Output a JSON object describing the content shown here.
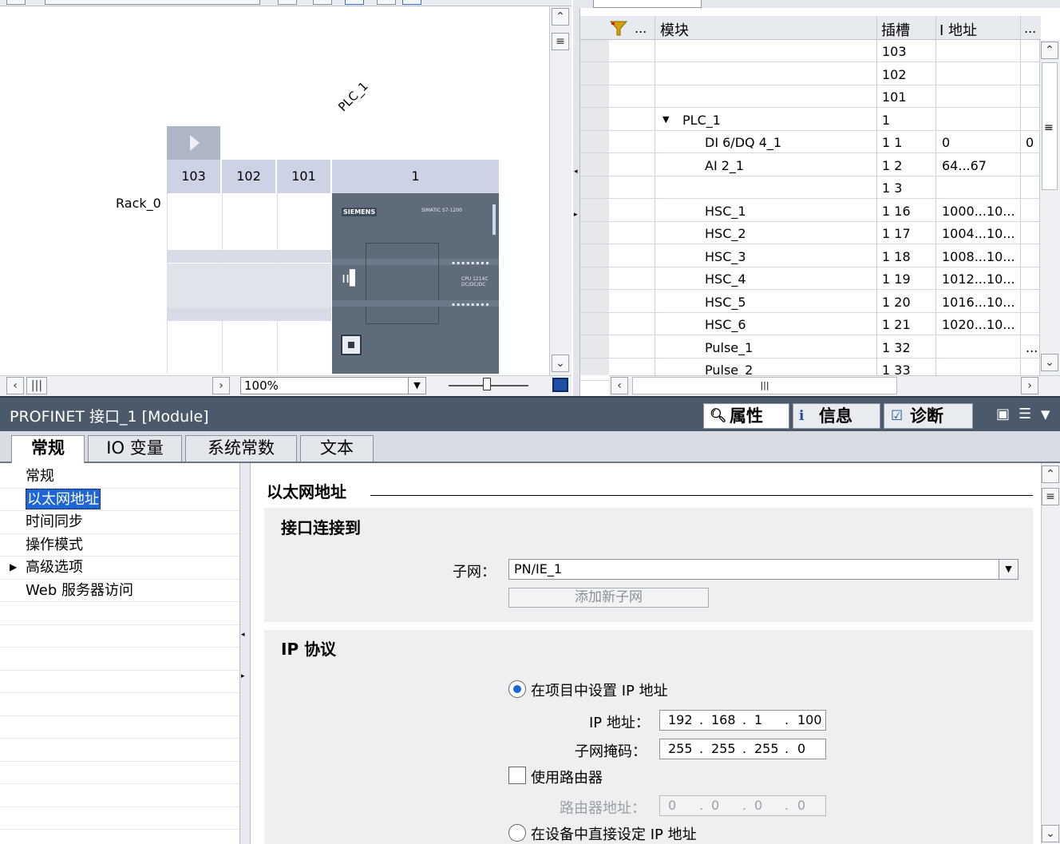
{
  "device_view": {
    "device_label": "PLC_1",
    "rack_label": "Rack_0",
    "slot_headers": [
      "103",
      "102",
      "101",
      "1"
    ],
    "module_brand": "SIEMENS",
    "module_model": "SIMATIC S7-1200",
    "cpu_text": "CPU 1214C DC/DC/DC",
    "zoom": "100%"
  },
  "overview": {
    "columns": [
      "模块",
      "插槽",
      "I 地址",
      "..."
    ],
    "col_dots": "...",
    "rows": [
      {
        "module": "",
        "slot": "103",
        "iaddr": "",
        "q": ""
      },
      {
        "module": "",
        "slot": "102",
        "iaddr": "",
        "q": ""
      },
      {
        "module": "",
        "slot": "101",
        "iaddr": "",
        "q": ""
      },
      {
        "module": "PLC_1",
        "slot": "1",
        "iaddr": "",
        "q": ""
      },
      {
        "module": "DI 6/DQ 4_1",
        "slot": "1 1",
        "iaddr": "0",
        "q": "0"
      },
      {
        "module": "AI 2_1",
        "slot": "1 2",
        "iaddr": "64...67",
        "q": ""
      },
      {
        "module": "",
        "slot": "1 3",
        "iaddr": "",
        "q": ""
      },
      {
        "module": "HSC_1",
        "slot": "1 16",
        "iaddr": "1000...10...",
        "q": ""
      },
      {
        "module": "HSC_2",
        "slot": "1 17",
        "iaddr": "1004...10...",
        "q": ""
      },
      {
        "module": "HSC_3",
        "slot": "1 18",
        "iaddr": "1008...10...",
        "q": ""
      },
      {
        "module": "HSC_4",
        "slot": "1 19",
        "iaddr": "1012...10...",
        "q": ""
      },
      {
        "module": "HSC_5",
        "slot": "1 20",
        "iaddr": "1016...10...",
        "q": ""
      },
      {
        "module": "HSC_6",
        "slot": "1 21",
        "iaddr": "1020...10...",
        "q": ""
      },
      {
        "module": "Pulse_1",
        "slot": "1 32",
        "iaddr": "",
        "q": "..."
      },
      {
        "module": "Pulse_2",
        "slot": "1 33",
        "iaddr": "",
        "q": ""
      }
    ]
  },
  "properties": {
    "title": "PROFINET 接口_1 [Module]",
    "panel_tabs": [
      "属性",
      "信息",
      "诊断"
    ],
    "tabs": [
      "常规",
      "IO 变量",
      "系统常数",
      "文本"
    ],
    "nav": [
      "常规",
      "以太网地址",
      "时间同步",
      "操作模式",
      "高级选项",
      "Web 服务器访问"
    ],
    "section_title": "以太网地址",
    "group1_title": "接口连接到",
    "subnet_label": "子网：",
    "subnet_value": "PN/IE_1",
    "add_subnet": "添加新子网",
    "group2_title": "IP 协议",
    "radio_project": "在项目中设置 IP 地址",
    "ip_label": "IP 地址：",
    "ip": [
      "192",
      "168",
      "1",
      "100"
    ],
    "mask_label": "子网掩码：",
    "mask": [
      "255",
      "255",
      "255",
      "0"
    ],
    "use_router": "使用路由器",
    "router_label": "路由器地址：",
    "router": [
      "0",
      "0",
      "0",
      "0"
    ],
    "radio_device": "在设备中直接设定 IP 地址"
  }
}
